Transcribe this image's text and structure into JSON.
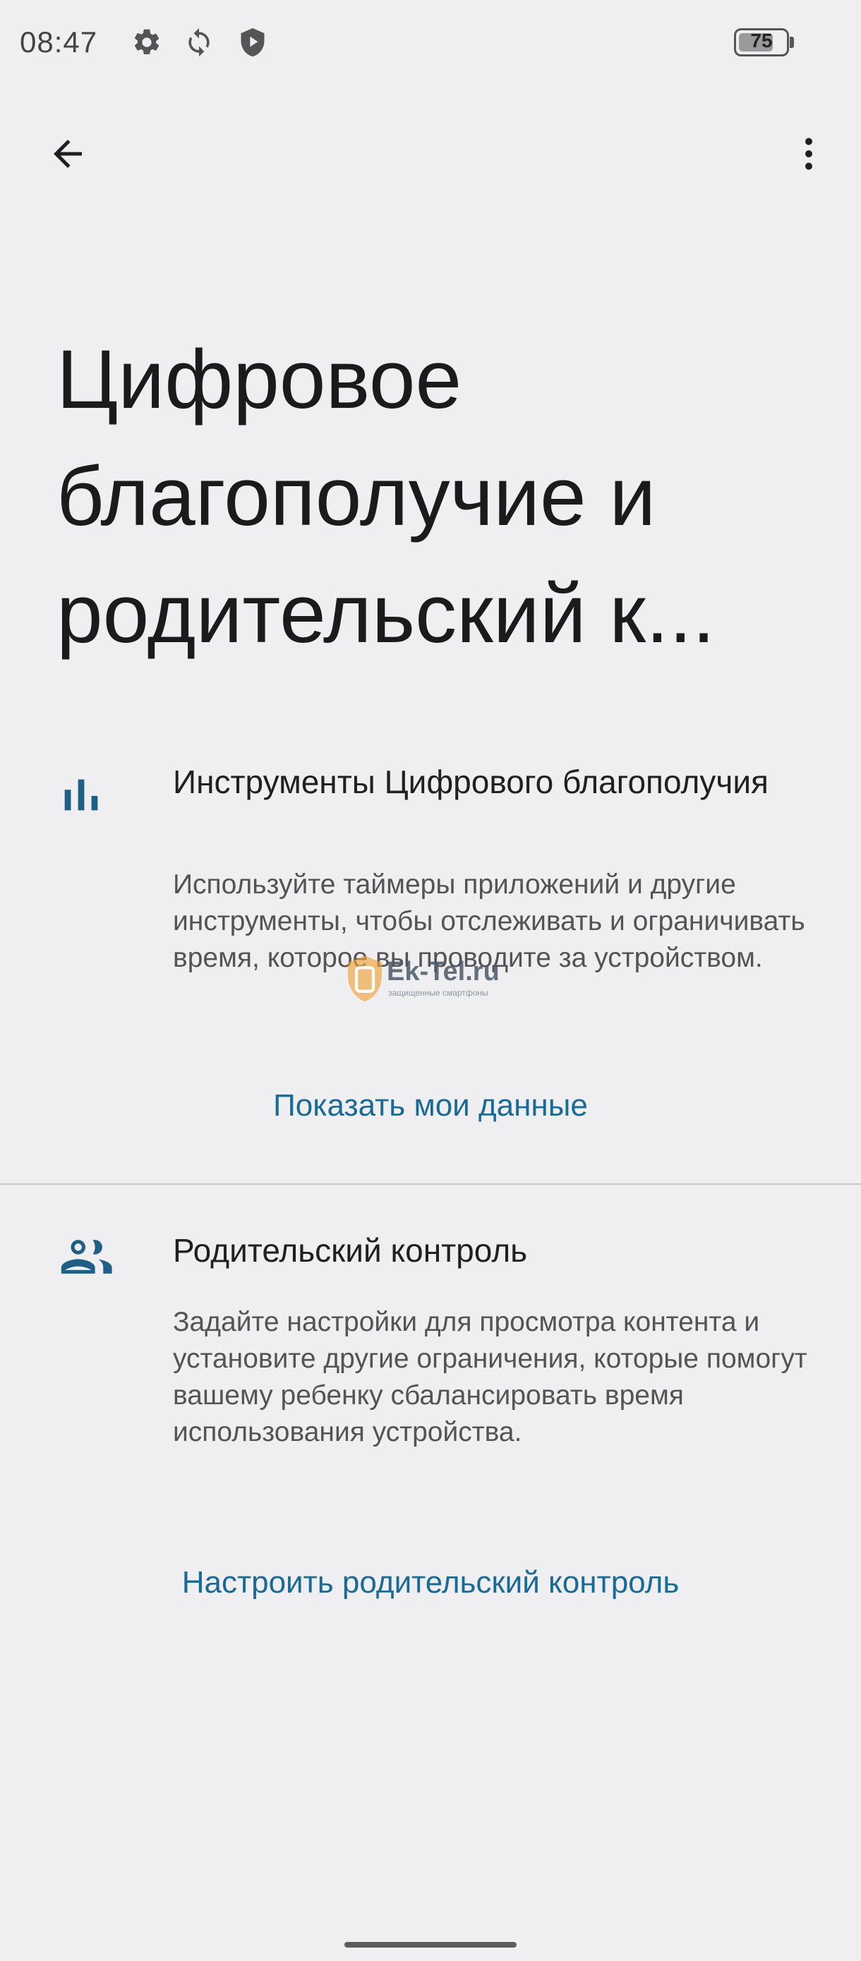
{
  "status_bar": {
    "time": "08:47",
    "icons": [
      "gear-icon",
      "sync-icon",
      "shield-play-icon"
    ],
    "battery": "75",
    "battery_level": 0.75
  },
  "toolbar": {
    "back_icon": "arrow-back-icon",
    "menu_icon": "more-vert-icon"
  },
  "page": {
    "title": "Цифровое благополучие и родительский к..."
  },
  "digital_wellbeing": {
    "icon": "bar-chart-icon",
    "title": "Инструменты Цифрового благополучия",
    "description": "Используйте таймеры приложений и другие инструменты, чтобы отслеживать и ограничивать время, которое вы проводите за устройством.",
    "action": "Показать мои данные"
  },
  "parental_controls": {
    "icon": "family-icon",
    "title": "Родительский контроль",
    "description": "Задайте настройки для просмотра контента и установите другие ограничения, которые помогут вашему ребенку сбалансировать время использования устройства.",
    "action": "Настроить родительский контроль"
  },
  "watermark": {
    "brand": "Ek-Tel.ru",
    "tagline": "защищенные смартфоны"
  },
  "colors": {
    "background": "#efeef0",
    "accent": "#1a6a96",
    "icon": "#1f5f86"
  }
}
